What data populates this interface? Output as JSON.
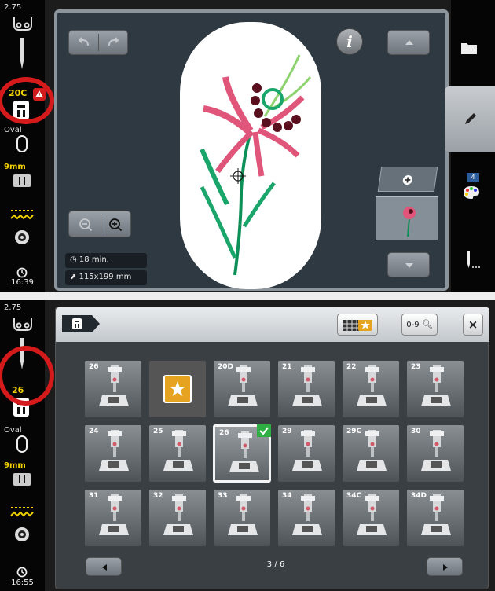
{
  "screen1": {
    "sidebar": {
      "tension": "2.75",
      "foot": "20C",
      "hoop": "Oval",
      "stitch_width": "9mm",
      "time": "16:39"
    },
    "info": {
      "duration": "18 min.",
      "size": "115x199 mm"
    },
    "layer_badge": "4",
    "info_button": "i"
  },
  "screen2": {
    "sidebar": {
      "tension": "2.75",
      "foot": "26",
      "hoop": "Oval",
      "stitch_width": "9mm",
      "time": "16:55"
    },
    "search_label": "0-9",
    "close_label": "×",
    "page_indicator": "3 / 6",
    "feet_tiles": [
      {
        "label": "26"
      },
      {
        "label": ""
      },
      {
        "label": "20D"
      },
      {
        "label": "21"
      },
      {
        "label": "22"
      },
      {
        "label": "23"
      },
      {
        "label": "24"
      },
      {
        "label": "25"
      },
      {
        "label": "26"
      },
      {
        "label": "29"
      },
      {
        "label": "29C"
      },
      {
        "label": "30"
      },
      {
        "label": "31"
      },
      {
        "label": "32"
      },
      {
        "label": "33"
      },
      {
        "label": "34"
      },
      {
        "label": "34C"
      },
      {
        "label": "34D"
      }
    ]
  },
  "colors": {
    "accent_yellow": "#f2d200",
    "highlight_ring": "#d41a1a",
    "selected_check": "#2fae44",
    "favorite_gold": "#e6a320"
  }
}
